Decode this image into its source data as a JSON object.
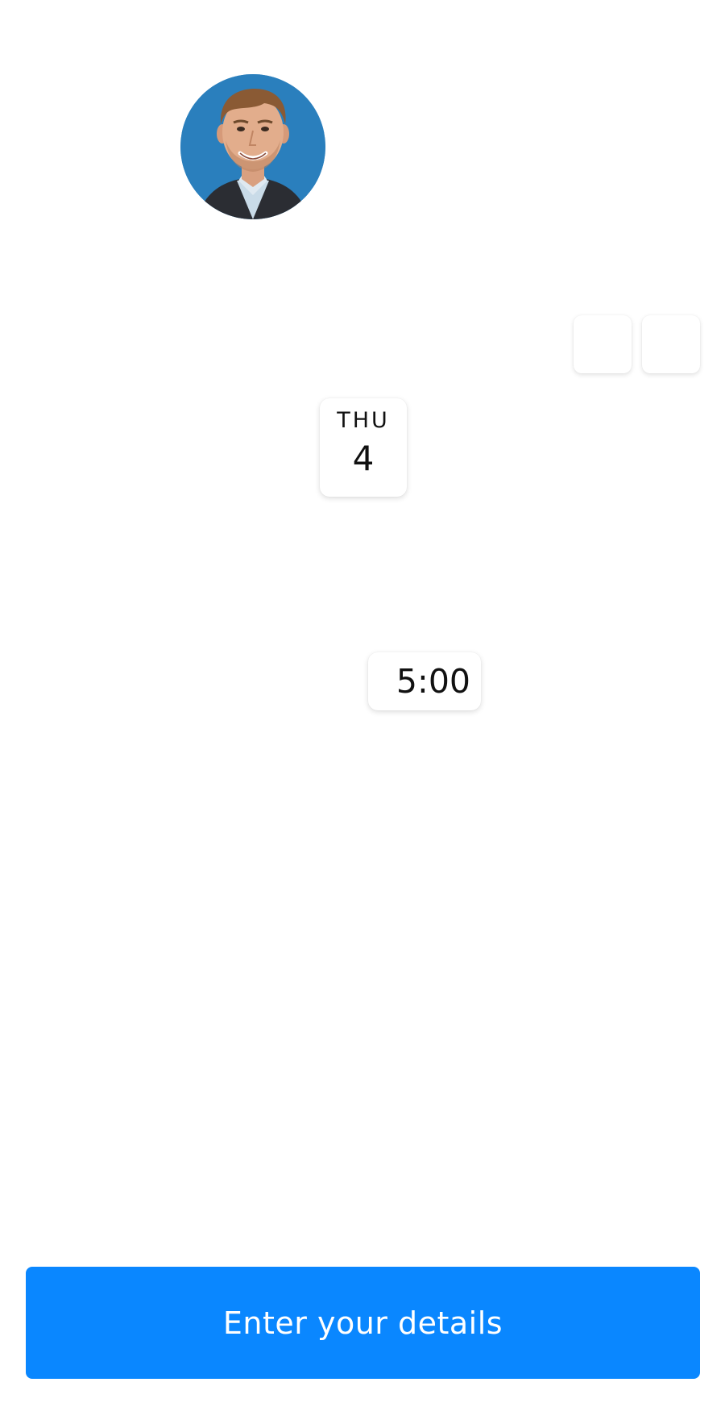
{
  "host": {
    "avatar_icon": "person-photo",
    "avatar_bg": "#2a7fbd"
  },
  "calendar": {
    "prev_icon": "chevron-left-icon",
    "next_icon": "chevron-right-icon",
    "selected_date": {
      "day_of_week": "THU",
      "day": "4"
    }
  },
  "slots": {
    "selected_time": "5:00"
  },
  "cta": {
    "label": "Enter your details",
    "color": "#0a87ff"
  }
}
